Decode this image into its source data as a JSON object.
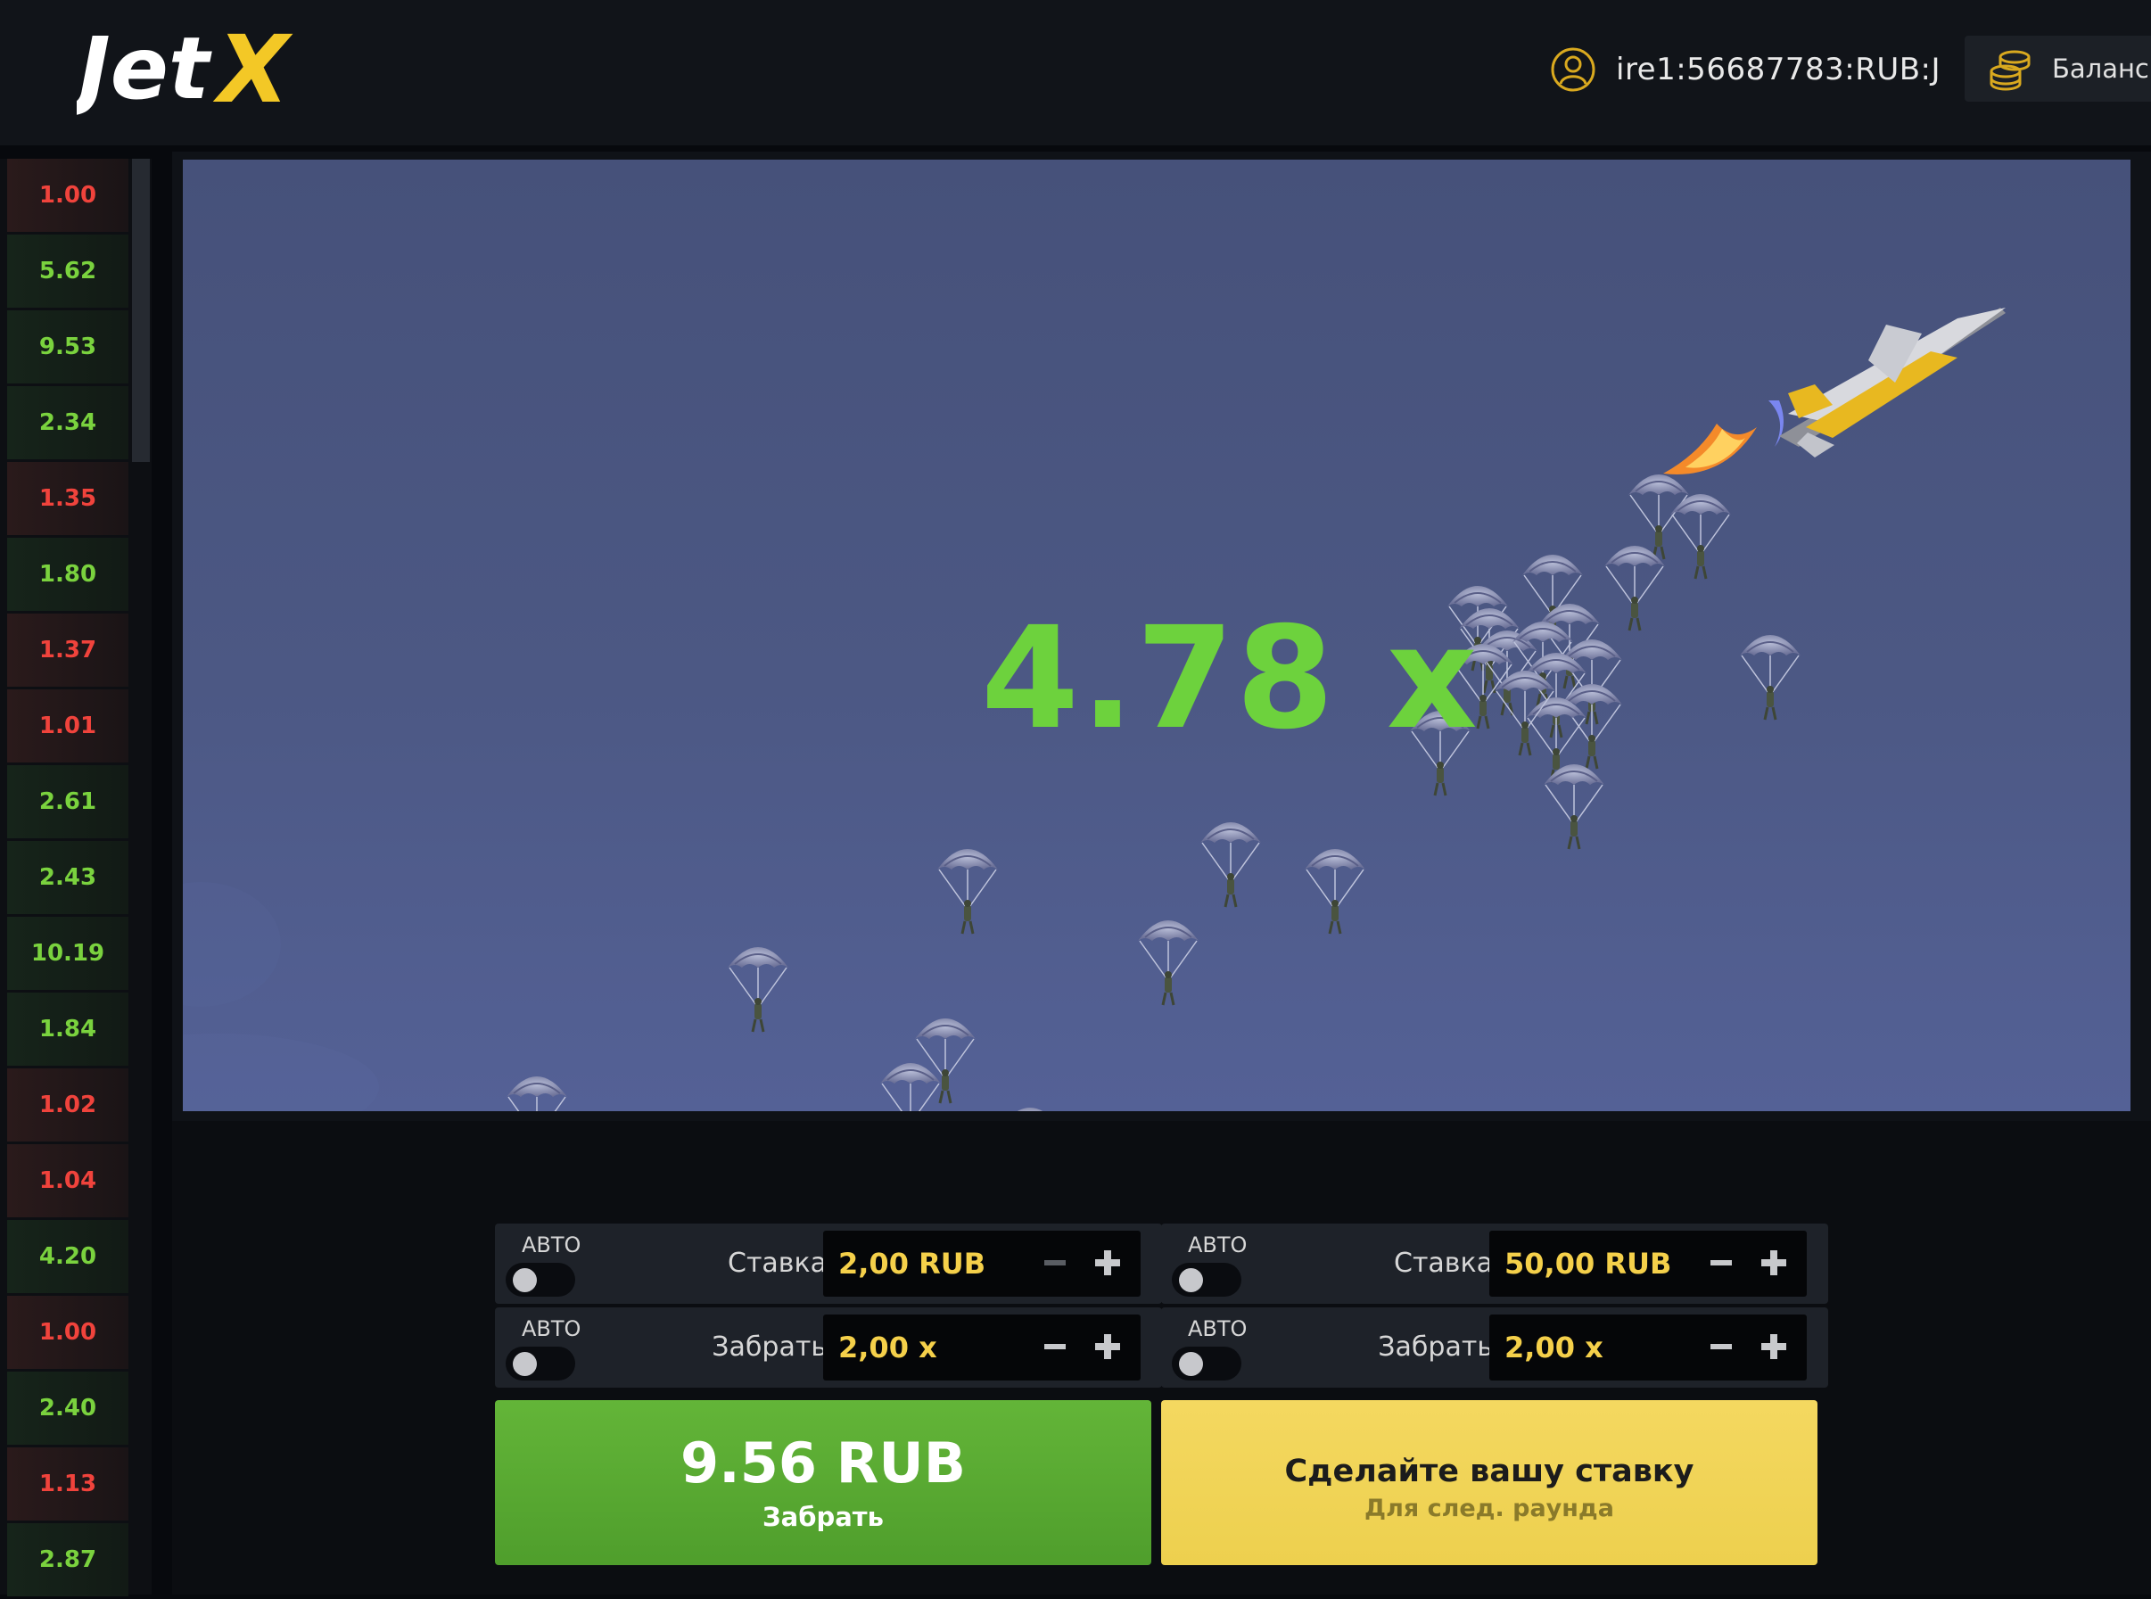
{
  "header": {
    "logo_text": "JetX",
    "username": "ire1:56687783:RUB:J",
    "balance_label": "Баланс"
  },
  "history": [
    "1.00",
    "5.62",
    "9.53",
    "2.34",
    "1.35",
    "1.80",
    "1.37",
    "1.01",
    "2.61",
    "2.43",
    "10.19",
    "1.84",
    "1.02",
    "1.04",
    "4.20",
    "1.00",
    "2.40",
    "1.13",
    "2.87"
  ],
  "game": {
    "multiplier": "4.78 x"
  },
  "panels": [
    {
      "stake": {
        "auto_label": "АВТО",
        "label": "Ставка",
        "value": "2,00 RUB"
      },
      "cashout": {
        "auto_label": "АВТО",
        "label": "Забрать",
        "value": "2,00 x"
      },
      "button": {
        "amount": "9.56 RUB",
        "sub": "Забрать"
      }
    },
    {
      "stake": {
        "auto_label": "АВТО",
        "label": "Ставка",
        "value": "50,00 RUB"
      },
      "cashout": {
        "auto_label": "АВТО",
        "label": "Забрать",
        "value": "2,00 x"
      },
      "button": {
        "title": "Сделайте вашу ставку",
        "sub": "Для след. раунда"
      }
    }
  ],
  "colors": {
    "win": "#7ad23e",
    "loss": "#f0433c",
    "accent_yellow": "#f5d04a",
    "cashout_green": "#5aab32",
    "bet_yellow": "#f0d355"
  }
}
